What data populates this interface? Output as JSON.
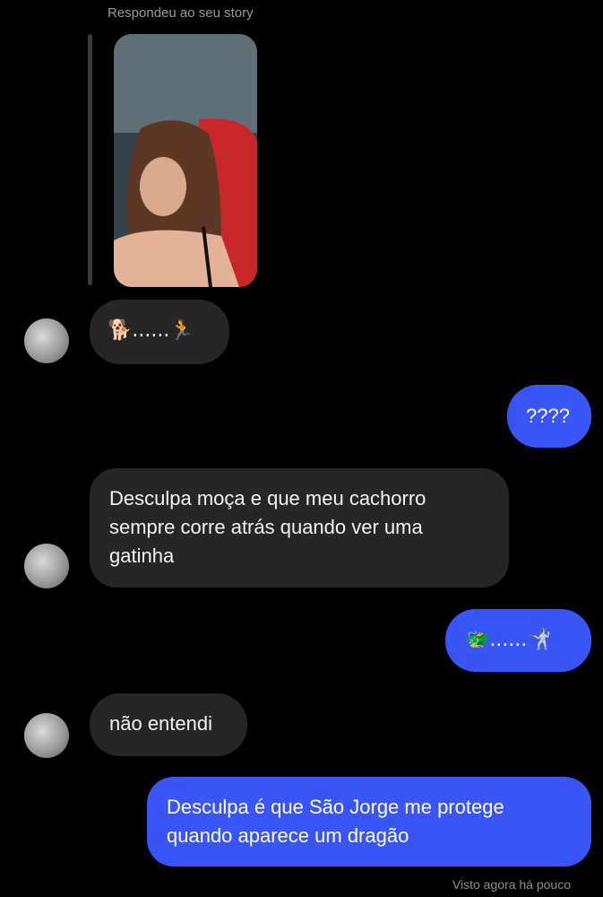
{
  "story": {
    "reply_caption": "Respondeu ao seu story"
  },
  "messages": [
    {
      "from": "them",
      "text": "🐕......🏃"
    },
    {
      "from": "me",
      "text": "????"
    },
    {
      "from": "them",
      "lines": [
        "Desculpa moça e que meu cachorro",
        "sempre corre atrás quando ver uma",
        "gatinha"
      ]
    },
    {
      "from": "me",
      "text": "🐲......🤺"
    },
    {
      "from": "them",
      "text": "não entendi"
    },
    {
      "from": "me",
      "lines": [
        "Desculpa é que São Jorge me protege",
        "quando aparece um dragão"
      ]
    }
  ],
  "status": {
    "seen_text": "Visto agora há pouco"
  },
  "colors": {
    "incoming_bubble": "#262626",
    "outgoing_bubble": "#3a55f5",
    "background": "#000000"
  }
}
